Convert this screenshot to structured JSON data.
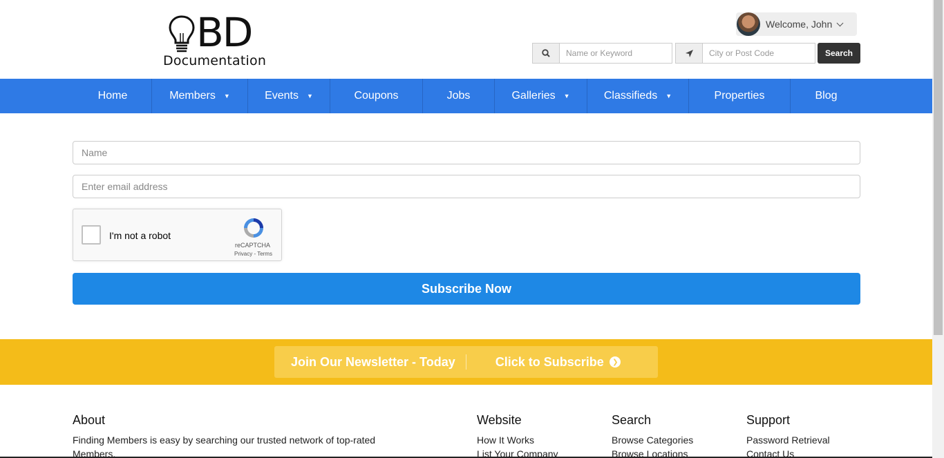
{
  "header": {
    "logo_bd": "BD",
    "logo_doc": "Documentation",
    "welcome": "Welcome, John",
    "search_keyword_placeholder": "Name or Keyword",
    "search_location_placeholder": "City or Post Code",
    "search_button": "Search"
  },
  "nav": {
    "items": [
      {
        "label": "Home",
        "dropdown": false
      },
      {
        "label": "Members",
        "dropdown": true
      },
      {
        "label": "Events",
        "dropdown": true
      },
      {
        "label": "Coupons",
        "dropdown": false
      },
      {
        "label": "Jobs",
        "dropdown": false
      },
      {
        "label": "Galleries",
        "dropdown": true
      },
      {
        "label": "Classifieds",
        "dropdown": true
      },
      {
        "label": "Properties",
        "dropdown": false
      },
      {
        "label": "Blog",
        "dropdown": false
      }
    ]
  },
  "form": {
    "name_placeholder": "Name",
    "email_placeholder": "Enter email address",
    "captcha_label": "I'm not a robot",
    "captcha_brand": "reCAPTCHA",
    "captcha_links": "Privacy - Terms",
    "subscribe_button": "Subscribe Now"
  },
  "newsletter": {
    "join": "Join Our Newsletter - Today",
    "click": "Click to Subscribe"
  },
  "footer": {
    "about": {
      "title": "About",
      "text": "Finding Members is easy by searching our trusted network of top-rated Members."
    },
    "website": {
      "title": "Website",
      "links": [
        "How It Works",
        "List Your Company"
      ]
    },
    "search": {
      "title": "Search",
      "links": [
        "Browse Categories",
        "Browse Locations"
      ]
    },
    "support": {
      "title": "Support",
      "links": [
        "Password Retrieval",
        "Contact Us"
      ]
    }
  },
  "colors": {
    "nav": "#2f7ae5",
    "subscribe": "#1e88e5",
    "newsletter": "#f4bc19"
  }
}
